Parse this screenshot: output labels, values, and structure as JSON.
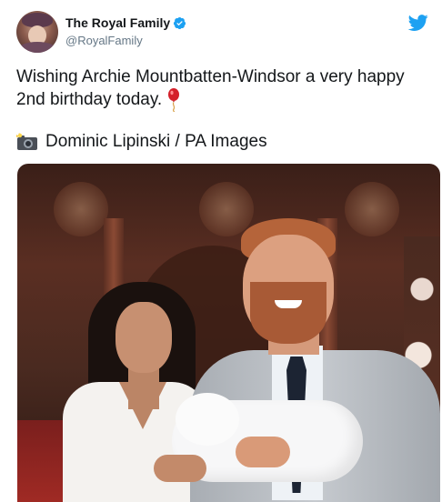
{
  "account": {
    "display_name": "The Royal Family",
    "handle": "@RoyalFamily",
    "verified": true,
    "avatar": "queen-portrait-avatar"
  },
  "icons": {
    "verified": "verified-badge-icon",
    "twitter": "twitter-bird-icon",
    "balloon": "balloon-emoji-icon",
    "camera": "camera-flash-emoji-icon"
  },
  "tweet": {
    "text_line_1": "Wishing Archie Mountbatten-Windsor a very happy",
    "text_line_2": "2nd birthday today.",
    "credit": "Dominic Lipinski / PA Images"
  },
  "colors": {
    "twitter_blue": "#1da1f2",
    "text": "#14171a",
    "secondary": "#657786"
  }
}
